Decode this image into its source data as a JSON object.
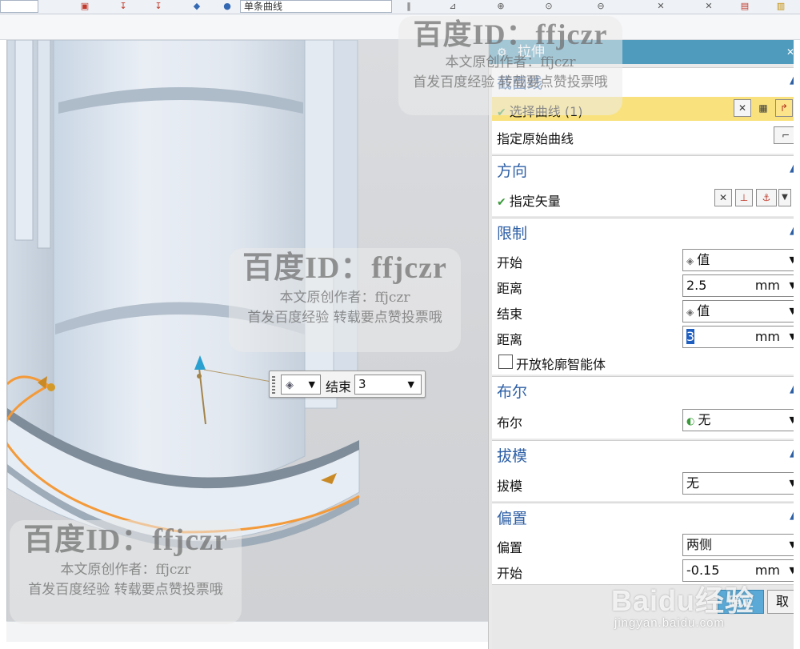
{
  "toolbar": {
    "curve_filter": "单条曲线"
  },
  "dialog": {
    "title": "拉伸",
    "sections": {
      "section_curve": {
        "title": "截面线",
        "select_curve": "选择曲线 (1)",
        "specify_original": "指定原始曲线"
      },
      "direction": {
        "title": "方向",
        "specify_vector": "指定矢量"
      },
      "limits": {
        "title": "限制",
        "start_label": "开始",
        "start_value": "值",
        "start_distance_label": "距离",
        "start_distance": "2.5",
        "end_label": "结束",
        "end_value": "值",
        "end_distance_label": "距离",
        "end_distance": "3",
        "unit": "mm",
        "open_profile": "开放轮廓智能体"
      },
      "boolean": {
        "title": "布尔",
        "label": "布尔",
        "value": "无"
      },
      "draft": {
        "title": "拔模",
        "label": "拔模",
        "value": "无"
      },
      "offset": {
        "title": "偏置",
        "label": "偏置",
        "value": "两侧",
        "start_label": "开始",
        "start_value": "-0.15",
        "unit": "mm"
      }
    },
    "ok": "确定",
    "cancel": "取"
  },
  "float_widget": {
    "label": "结束",
    "value": "3"
  },
  "watermark": {
    "id": "百度ID：ffjczr",
    "line1": "本文原创作者：ffjczr",
    "line2": "首发百度经验 转载要点赞投票哦",
    "logo": "Baidu经验",
    "url": "jingyan.baidu.com"
  },
  "colors": {
    "title_bar": "#4f9bbd",
    "section_title": "#2d5fa5",
    "selection_highlight": "#f9e27d",
    "active_selection": "#1f5fbf",
    "ok_button": "#5aa9d6",
    "edge_highlight": "#f39a3a"
  }
}
